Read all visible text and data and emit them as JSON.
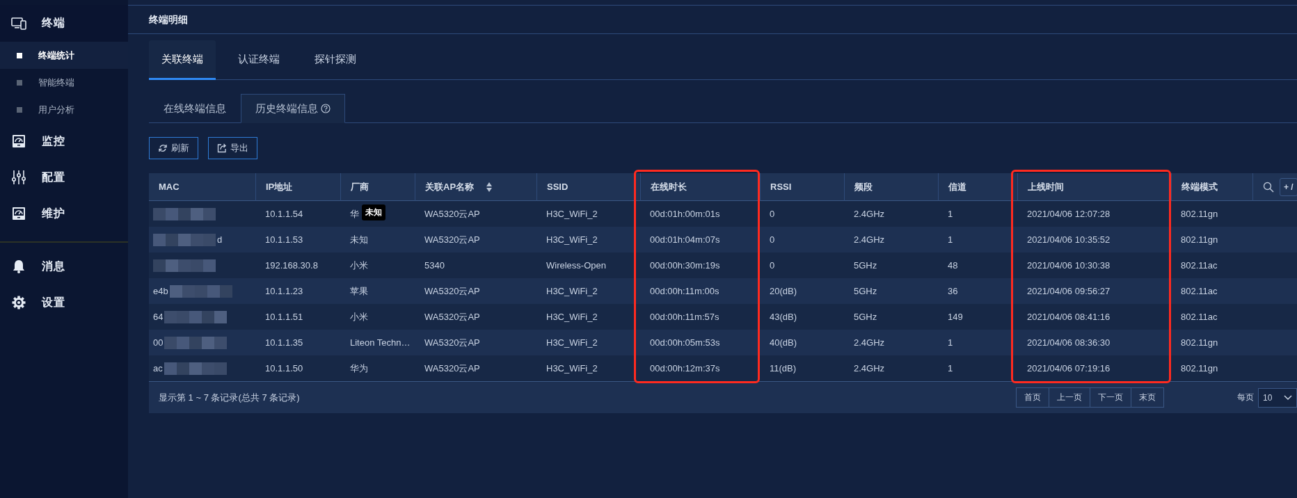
{
  "sidebar": {
    "groups": [
      {
        "label": "终端",
        "kind": "terminal",
        "children": [
          {
            "label": "终端统计",
            "selected": true
          },
          {
            "label": "智能终端",
            "selected": false
          },
          {
            "label": "用户分析",
            "selected": false
          }
        ]
      },
      {
        "label": "监控",
        "kind": "monitor"
      },
      {
        "label": "配置",
        "kind": "sliders"
      },
      {
        "label": "维护",
        "kind": "monitor"
      }
    ],
    "bottom_groups": [
      {
        "label": "消息",
        "kind": "bell"
      },
      {
        "label": "设置",
        "kind": "gear"
      }
    ]
  },
  "header": {
    "title": "终端明细"
  },
  "tabs": [
    {
      "label": "关联终端",
      "selected": true
    },
    {
      "label": "认证终端",
      "selected": false
    },
    {
      "label": "探针探测",
      "selected": false
    }
  ],
  "subtabs": [
    {
      "label": "在线终端信息",
      "selected": false,
      "help": false
    },
    {
      "label": "历史终端信息",
      "selected": true,
      "help": true
    }
  ],
  "toolbar": [
    {
      "label": "刷新",
      "kind": "refresh"
    },
    {
      "label": "导出",
      "kind": "export"
    }
  ],
  "table": {
    "columns": [
      {
        "label": "MAC",
        "sortable": false,
        "highlighted": false
      },
      {
        "label": "IP地址",
        "sortable": false,
        "highlighted": false
      },
      {
        "label": "厂商",
        "sortable": false,
        "highlighted": false
      },
      {
        "label": "关联AP名称",
        "sortable": true,
        "highlighted": false
      },
      {
        "label": "SSID",
        "sortable": false,
        "highlighted": false
      },
      {
        "label": "在线时长",
        "sortable": false,
        "highlighted": true
      },
      {
        "label": "RSSI",
        "sortable": false,
        "highlighted": false
      },
      {
        "label": "频段",
        "sortable": false,
        "highlighted": false
      },
      {
        "label": "信道",
        "sortable": false,
        "highlighted": false
      },
      {
        "label": "上线时间",
        "sortable": false,
        "highlighted": true
      },
      {
        "label": "终端模式",
        "sortable": false,
        "highlighted": false
      }
    ],
    "add_button": "+ /",
    "rows": [
      {
        "mac_redacted": true,
        "kind": "prefixed",
        "cells": [
          "",
          "10.1.1.54",
          "华",
          "WA5320云AP",
          "H3C_WiFi_2",
          "00d:01h:00m:01s",
          "0",
          "2.4GHz",
          "1",
          "2021/04/06 12:07:28",
          "802.11gn"
        ],
        "tooltip": "未知"
      },
      {
        "mac_redacted": true,
        "kind": "suffixed",
        "cells": [
          "d",
          "10.1.1.53",
          "未知",
          "WA5320云AP",
          "H3C_WiFi_2",
          "00d:01h:04m:07s",
          "0",
          "2.4GHz",
          "1",
          "2021/04/06 10:35:52",
          "802.11gn"
        ]
      },
      {
        "mac_redacted": true,
        "kind": "prefixed",
        "cells": [
          "",
          "192.168.30.8",
          "小米",
          "5340",
          "Wireless-Open",
          "00d:00h:30m:19s",
          "0",
          "5GHz",
          "48",
          "2021/04/06 10:30:38",
          "802.11ac"
        ]
      },
      {
        "mac_redacted": true,
        "kind": "prefixed",
        "cells": [
          "e4b",
          "10.1.1.23",
          "苹果",
          "WA5320云AP",
          "H3C_WiFi_2",
          "00d:00h:11m:00s",
          "20(dB)",
          "5GHz",
          "36",
          "2021/04/06 09:56:27",
          "802.11ac"
        ]
      },
      {
        "mac_redacted": true,
        "kind": "prefixed",
        "cells": [
          "64",
          "10.1.1.51",
          "小米",
          "WA5320云AP",
          "H3C_WiFi_2",
          "00d:00h:11m:57s",
          "43(dB)",
          "5GHz",
          "149",
          "2021/04/06 08:41:16",
          "802.11ac"
        ]
      },
      {
        "mac_redacted": true,
        "kind": "prefixed",
        "cells": [
          "00",
          "10.1.1.35",
          "Liteon Techn…",
          "WA5320云AP",
          "H3C_WiFi_2",
          "00d:00h:05m:53s",
          "40(dB)",
          "2.4GHz",
          "1",
          "2021/04/06 08:36:30",
          "802.11gn"
        ]
      },
      {
        "mac_redacted": true,
        "kind": "prefixed",
        "cells": [
          "ac",
          "10.1.1.50",
          "华为",
          "WA5320云AP",
          "H3C_WiFi_2",
          "00d:00h:12m:37s",
          "11(dB)",
          "2.4GHz",
          "1",
          "2021/04/06 07:19:16",
          "802.11gn"
        ]
      }
    ],
    "summary": "显示第 1 ~ 7 条记录(总共 7 条记录)",
    "pager": [
      "首页",
      "上一页",
      "下一页",
      "末页"
    ],
    "page_size_label": "每页",
    "page_size": "10"
  }
}
